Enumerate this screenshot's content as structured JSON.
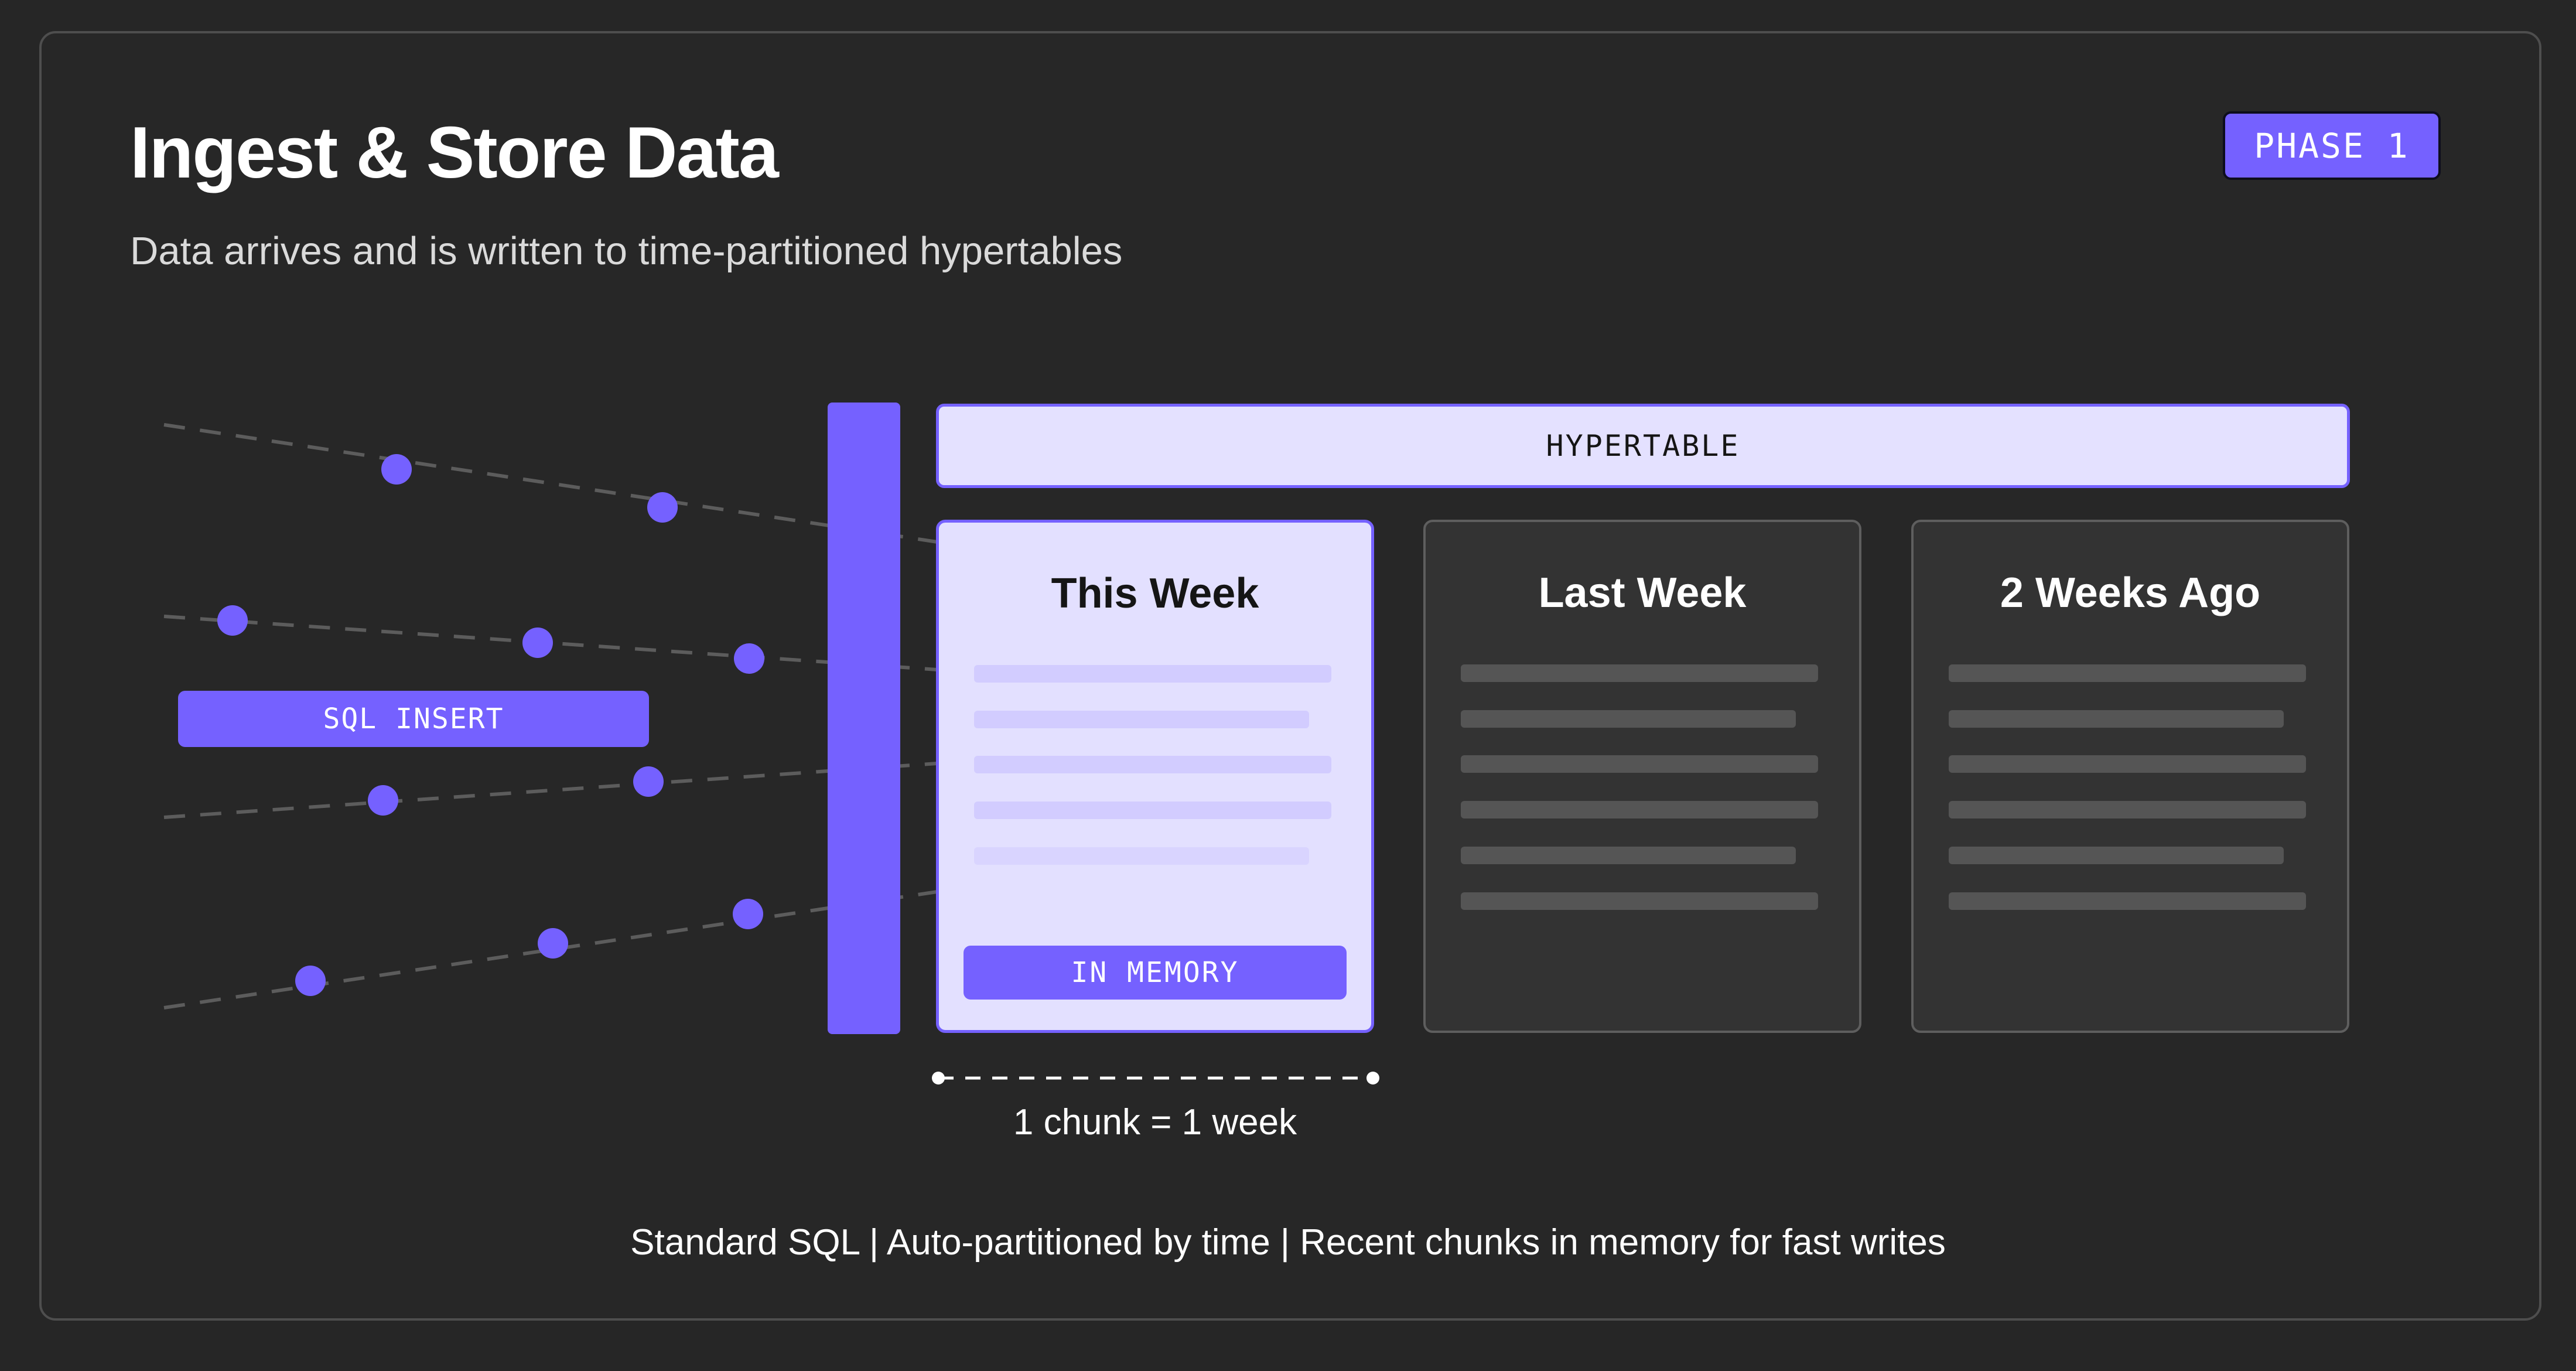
{
  "header": {
    "title": "Ingest & Store Data",
    "subtitle": "Data arrives and is written to time-partitioned hypertables",
    "phase_badge": "PHASE 1"
  },
  "ingest": {
    "sql_label": "SQL INSERT"
  },
  "hypertable": {
    "label": "HYPERTABLE",
    "chunks": [
      {
        "title": "This Week",
        "badge": "IN MEMORY"
      },
      {
        "title": "Last Week"
      },
      {
        "title": "2 Weeks Ago"
      }
    ],
    "chunk_size_label": "1 chunk = 1 week"
  },
  "footer": {
    "text": "Standard SQL | Auto-partitioned by time | Recent chunks in memory for fast writes"
  },
  "colors": {
    "accent": "#7561ff",
    "background": "#262626",
    "chunk_current_bg": "#e3e0ff",
    "chunk_old_bg": "#333333"
  }
}
